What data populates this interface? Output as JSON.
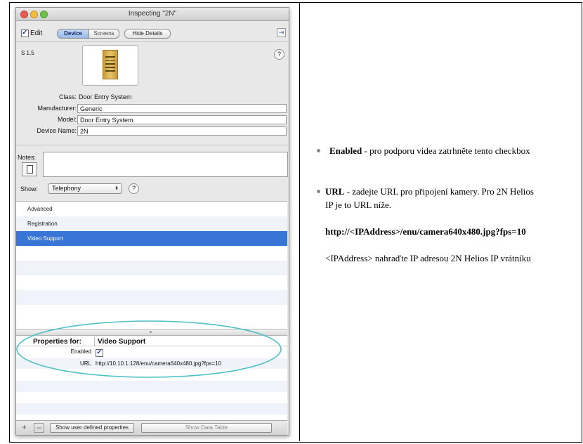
{
  "window": {
    "title": "Inspecting \"2N\"",
    "edit_label": "Edit",
    "tab_device": "Device",
    "tab_screens": "Screens",
    "hide_details": "Hide Details",
    "version": "S 1.5",
    "help": "?"
  },
  "device": {
    "class_label": "Class:",
    "class_value": "Door Entry System",
    "manufacturer_label": "Manufacturer:",
    "manufacturer_value": "Generic",
    "model_label": "Model:",
    "model_value": "Door Entry System",
    "name_label": "Device Name:",
    "name_value": "2N",
    "notes_label": "Notes:"
  },
  "show": {
    "label": "Show:",
    "value": "Telephony",
    "arrow": "⌃⌄"
  },
  "list_items": [
    "Advanced",
    "Registration",
    "Video Support"
  ],
  "properties": {
    "for_label": "Properties for:",
    "for_value": "Video Support",
    "enabled_label": "Enabled",
    "url_label": "URL",
    "url_value": "http://10.10.1.128/enu/camera640x480.jpg?fps=10"
  },
  "bottom": {
    "add": "+",
    "remove": "−",
    "show_user": "Show user defined properties",
    "show_table": "Show Data Table"
  },
  "doc": {
    "enabled_bold": "Enabled",
    "enabled_text": " - pro podporu videa zatrhněte tento checkbox",
    "url_bold": "URL",
    "url_text_1": " - zadejte URL pro připojení kamery. Pro 2N Helios",
    "url_text_2": "IP je to URL níže.",
    "url_example": "http://<IPAddress>/enu/camera640x480.jpg?fps=10",
    "replace_note": "<IPAddress> nahraďte IP adresou 2N Helios IP vrátníku"
  },
  "colors": {
    "selection": "#3875d7",
    "ellipse": "#4fc1c7"
  }
}
